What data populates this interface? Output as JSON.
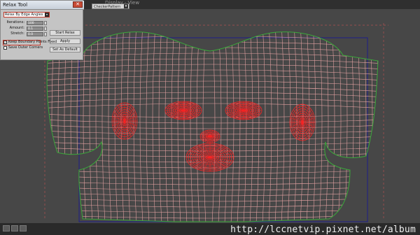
{
  "viewer": {
    "title": "Display · View",
    "checker_option": "CheckerPattern (Checker)"
  },
  "dialog": {
    "title": "Relax Tool",
    "close_glyph": "✕",
    "method": "Relax By Edge Angles",
    "params": [
      {
        "label": "Iterations:",
        "value": "100"
      },
      {
        "label": "Amount:",
        "value": "0.1"
      },
      {
        "label": "Stretch:",
        "value": "0.0"
      }
    ],
    "start_button": "Start Relax",
    "apply_button": "Apply",
    "default_button": "Set As Default",
    "checkboxes": [
      {
        "label": "Keep Boundary Points Fixed",
        "checked": true
      },
      {
        "label": "Save Outer Corners",
        "checked": false
      }
    ]
  },
  "watermark": "http://lccnetvip.pixnet.net/album",
  "colors": {
    "background": "#474747",
    "mesh_edge": "#e0a0a0",
    "dense_edge": "#ff2020",
    "boundary": "#3aa83a",
    "frame": "#1e1e8a",
    "guide": "#b05050"
  }
}
